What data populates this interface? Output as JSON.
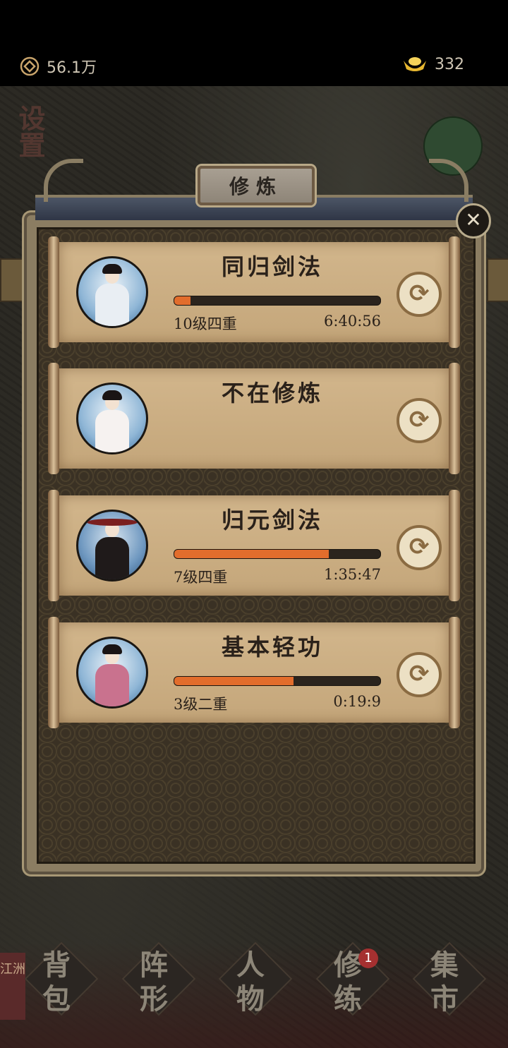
{
  "header": {
    "coins": "56.1万",
    "gold": "332"
  },
  "map": {
    "settings_label": "设置",
    "region_tag": "江洲"
  },
  "panel": {
    "title": "修炼",
    "close_symbol": "✕"
  },
  "cultivation": [
    {
      "skill": "同归剑法",
      "level": "10级四重",
      "time": "6:40:56",
      "progress": 0.08,
      "has_progress": true,
      "portrait": "white-robed-swordswoman"
    },
    {
      "skill": "不在修炼",
      "level": "",
      "time": "",
      "progress": 0,
      "has_progress": false,
      "portrait": "fan-dancer"
    },
    {
      "skill": "归元剑法",
      "level": "7级四重",
      "time": "1:35:47",
      "progress": 0.75,
      "has_progress": true,
      "portrait": "hat-wearing-swordsman"
    },
    {
      "skill": "基本轻功",
      "level": "3级二重",
      "time": "0:19:9",
      "progress": 0.58,
      "has_progress": true,
      "portrait": "pink-robed-swordsman"
    }
  ],
  "refresh_symbol": "⟳",
  "nav": [
    {
      "label": "背包"
    },
    {
      "label": "阵形"
    },
    {
      "label": "人物"
    },
    {
      "label": "修练",
      "badge": "1"
    },
    {
      "label": "集市"
    }
  ],
  "colors": {
    "progress_fill": "#e26d2c",
    "paper": "#cdb083",
    "frame": "#8b7d62"
  }
}
